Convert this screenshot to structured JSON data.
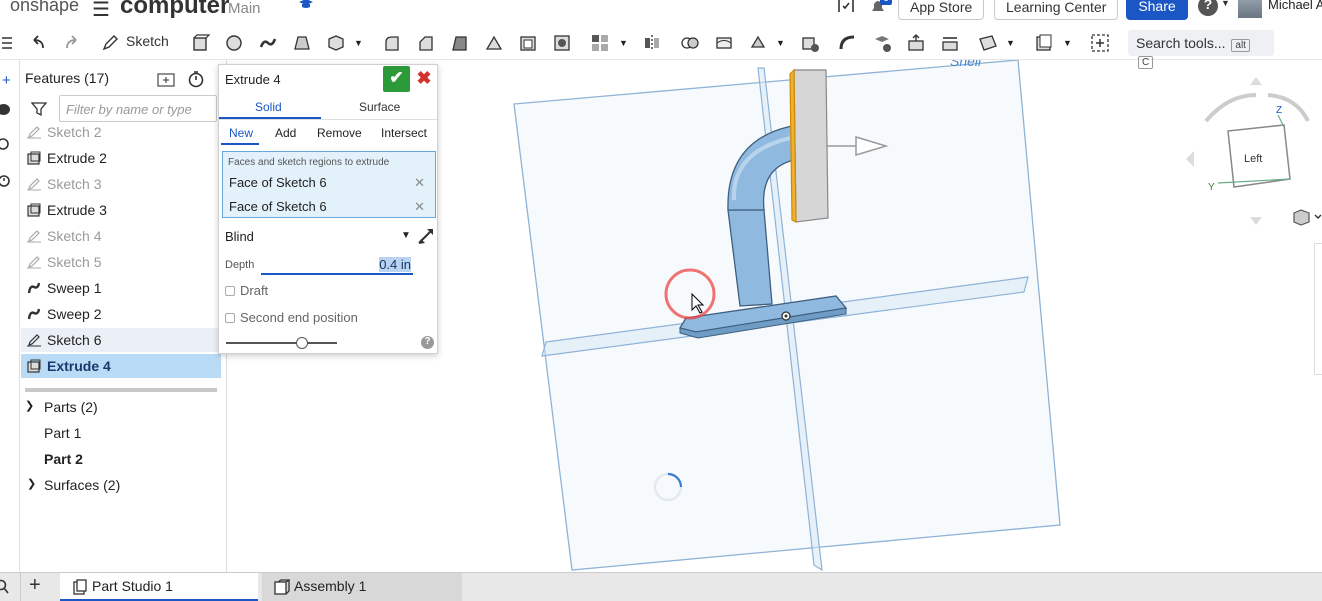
{
  "header": {
    "logo": "onshape",
    "doc_title": "computer",
    "branch": "Main",
    "app_store": "App Store",
    "learning_center": "Learning Center",
    "share": "Share",
    "user": "Michael A",
    "notif_count": "1"
  },
  "toolbar": {
    "sketch_label": "Sketch",
    "search_label": "Search tools...",
    "kbd1": "alt",
    "kbd2": "C"
  },
  "features": {
    "header": "Features (17)",
    "filter_placeholder": "Filter by name or type",
    "items": [
      {
        "label": "Sketch 2"
      },
      {
        "label": "Extrude 2"
      },
      {
        "label": "Sketch 3"
      },
      {
        "label": "Extrude 3"
      },
      {
        "label": "Sketch 4"
      },
      {
        "label": "Sketch 5"
      },
      {
        "label": "Sweep 1"
      },
      {
        "label": "Sweep 2"
      },
      {
        "label": "Sketch 6"
      },
      {
        "label": "Extrude 4"
      }
    ],
    "parts_label": "Parts (2)",
    "part1": "Part 1",
    "part2": "Part 2",
    "surfaces_label": "Surfaces (2)"
  },
  "dialog": {
    "title": "Extrude 4",
    "tab_solid": "Solid",
    "tab_surface": "Surface",
    "op_new": "New",
    "op_add": "Add",
    "op_remove": "Remove",
    "op_intersect": "Intersect",
    "faces_caption": "Faces and sketch regions to extrude",
    "faces": [
      "Face of Sketch 6",
      "Face of Sketch 6"
    ],
    "end_type": "Blind",
    "depth_label": "Depth",
    "depth_value": "0.4 in",
    "draft_label": "Draft",
    "second_end_label": "Second end position"
  },
  "viewcube": {
    "face_label": "Left",
    "axis_z": "Z",
    "axis_y": "Y"
  },
  "tabs": {
    "part_studio": "Part Studio 1",
    "assembly": "Assembly 1"
  },
  "colors": {
    "accent": "#1a56c4",
    "ok": "#2d9a3a",
    "cancel": "#d0332b",
    "selection": "#b9dbf6",
    "part_blue": "#8fb9de"
  }
}
